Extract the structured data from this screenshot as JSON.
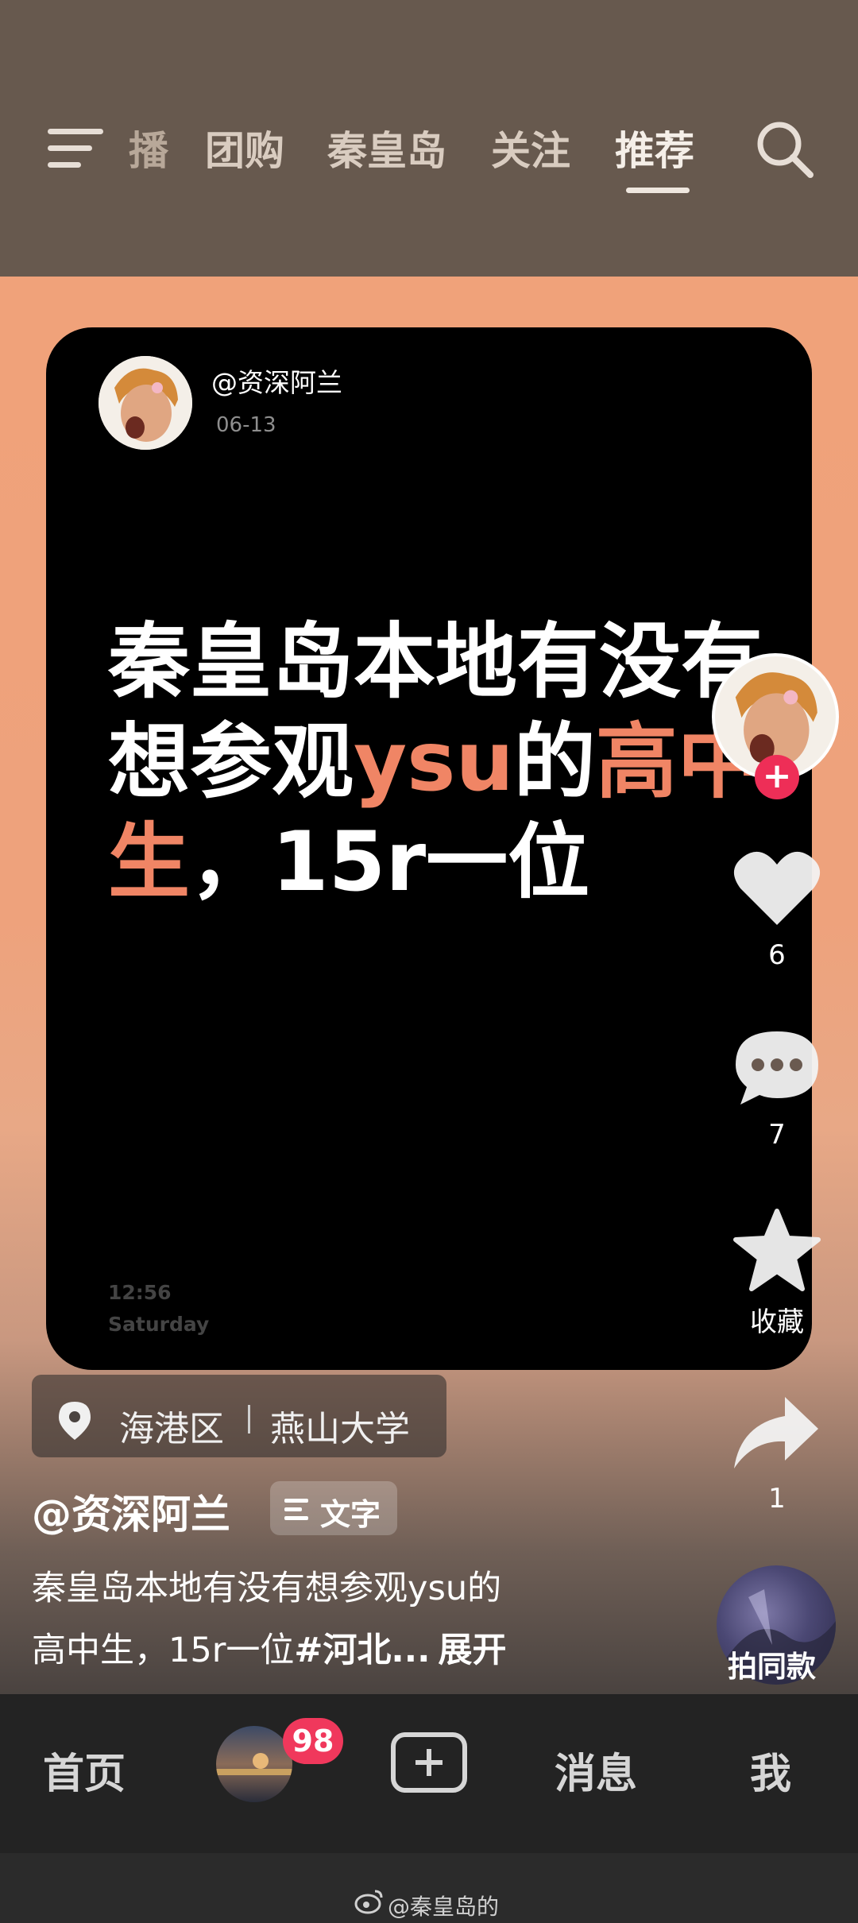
{
  "header": {
    "tabs": [
      {
        "label": "播",
        "state": "faded"
      },
      {
        "label": "团购",
        "state": "normal"
      },
      {
        "label": "秦皇岛",
        "state": "normal"
      },
      {
        "label": "关注",
        "state": "normal"
      },
      {
        "label": "推荐",
        "state": "active"
      }
    ],
    "menu_icon": "hamburger-icon",
    "search_icon": "search-icon"
  },
  "post_card": {
    "username": "@资深阿兰",
    "date": "06-13",
    "headline_parts": [
      "秦皇岛本地有没有想参观",
      "ysu",
      "的",
      "高中生",
      "，15r一位"
    ],
    "time": "12:56",
    "day": "Saturday"
  },
  "side_actions": {
    "like_count": "6",
    "comment_count": "7",
    "favorite_label": "收藏",
    "share_count": "1",
    "same_style_label": "拍同款",
    "follow_icon": "plus-icon"
  },
  "location": {
    "district": "海港区",
    "place": "燕山大学"
  },
  "post_info": {
    "author": "@资深阿兰",
    "type_label": "文字",
    "caption_line1": "秦皇岛本地有没有想参观ysu的",
    "caption_line2": "高中生，15r一位",
    "caption_tag": "#河北...",
    "expand_label": "展开"
  },
  "bottom_nav": {
    "home": "首页",
    "badge_count": "98",
    "messages": "消息",
    "me": "我"
  },
  "watermark": "@秦皇岛的",
  "colors": {
    "top_bar": "#67594e",
    "video_bg": "#f0a27a",
    "highlight": "#f08565",
    "badge": "#f0385c",
    "follow": "#ee2e57"
  }
}
